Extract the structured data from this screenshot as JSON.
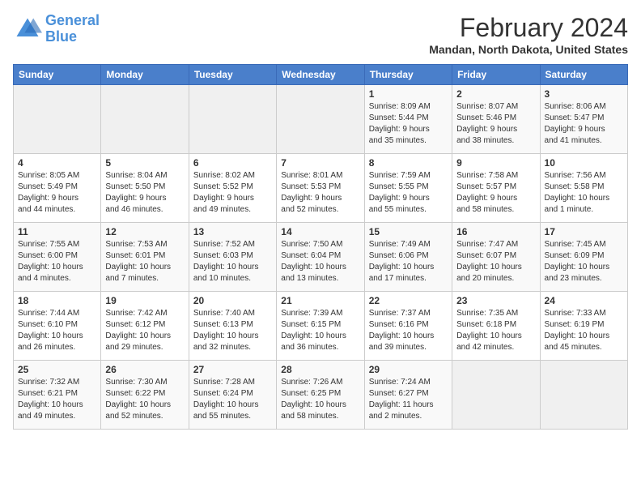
{
  "logo": {
    "line1": "General",
    "line2": "Blue"
  },
  "title": "February 2024",
  "subtitle": "Mandan, North Dakota, United States",
  "days_header": [
    "Sunday",
    "Monday",
    "Tuesday",
    "Wednesday",
    "Thursday",
    "Friday",
    "Saturday"
  ],
  "weeks": [
    [
      {
        "day": "",
        "info": ""
      },
      {
        "day": "",
        "info": ""
      },
      {
        "day": "",
        "info": ""
      },
      {
        "day": "",
        "info": ""
      },
      {
        "day": "1",
        "info": "Sunrise: 8:09 AM\nSunset: 5:44 PM\nDaylight: 9 hours\nand 35 minutes."
      },
      {
        "day": "2",
        "info": "Sunrise: 8:07 AM\nSunset: 5:46 PM\nDaylight: 9 hours\nand 38 minutes."
      },
      {
        "day": "3",
        "info": "Sunrise: 8:06 AM\nSunset: 5:47 PM\nDaylight: 9 hours\nand 41 minutes."
      }
    ],
    [
      {
        "day": "4",
        "info": "Sunrise: 8:05 AM\nSunset: 5:49 PM\nDaylight: 9 hours\nand 44 minutes."
      },
      {
        "day": "5",
        "info": "Sunrise: 8:04 AM\nSunset: 5:50 PM\nDaylight: 9 hours\nand 46 minutes."
      },
      {
        "day": "6",
        "info": "Sunrise: 8:02 AM\nSunset: 5:52 PM\nDaylight: 9 hours\nand 49 minutes."
      },
      {
        "day": "7",
        "info": "Sunrise: 8:01 AM\nSunset: 5:53 PM\nDaylight: 9 hours\nand 52 minutes."
      },
      {
        "day": "8",
        "info": "Sunrise: 7:59 AM\nSunset: 5:55 PM\nDaylight: 9 hours\nand 55 minutes."
      },
      {
        "day": "9",
        "info": "Sunrise: 7:58 AM\nSunset: 5:57 PM\nDaylight: 9 hours\nand 58 minutes."
      },
      {
        "day": "10",
        "info": "Sunrise: 7:56 AM\nSunset: 5:58 PM\nDaylight: 10 hours\nand 1 minute."
      }
    ],
    [
      {
        "day": "11",
        "info": "Sunrise: 7:55 AM\nSunset: 6:00 PM\nDaylight: 10 hours\nand 4 minutes."
      },
      {
        "day": "12",
        "info": "Sunrise: 7:53 AM\nSunset: 6:01 PM\nDaylight: 10 hours\nand 7 minutes."
      },
      {
        "day": "13",
        "info": "Sunrise: 7:52 AM\nSunset: 6:03 PM\nDaylight: 10 hours\nand 10 minutes."
      },
      {
        "day": "14",
        "info": "Sunrise: 7:50 AM\nSunset: 6:04 PM\nDaylight: 10 hours\nand 13 minutes."
      },
      {
        "day": "15",
        "info": "Sunrise: 7:49 AM\nSunset: 6:06 PM\nDaylight: 10 hours\nand 17 minutes."
      },
      {
        "day": "16",
        "info": "Sunrise: 7:47 AM\nSunset: 6:07 PM\nDaylight: 10 hours\nand 20 minutes."
      },
      {
        "day": "17",
        "info": "Sunrise: 7:45 AM\nSunset: 6:09 PM\nDaylight: 10 hours\nand 23 minutes."
      }
    ],
    [
      {
        "day": "18",
        "info": "Sunrise: 7:44 AM\nSunset: 6:10 PM\nDaylight: 10 hours\nand 26 minutes."
      },
      {
        "day": "19",
        "info": "Sunrise: 7:42 AM\nSunset: 6:12 PM\nDaylight: 10 hours\nand 29 minutes."
      },
      {
        "day": "20",
        "info": "Sunrise: 7:40 AM\nSunset: 6:13 PM\nDaylight: 10 hours\nand 32 minutes."
      },
      {
        "day": "21",
        "info": "Sunrise: 7:39 AM\nSunset: 6:15 PM\nDaylight: 10 hours\nand 36 minutes."
      },
      {
        "day": "22",
        "info": "Sunrise: 7:37 AM\nSunset: 6:16 PM\nDaylight: 10 hours\nand 39 minutes."
      },
      {
        "day": "23",
        "info": "Sunrise: 7:35 AM\nSunset: 6:18 PM\nDaylight: 10 hours\nand 42 minutes."
      },
      {
        "day": "24",
        "info": "Sunrise: 7:33 AM\nSunset: 6:19 PM\nDaylight: 10 hours\nand 45 minutes."
      }
    ],
    [
      {
        "day": "25",
        "info": "Sunrise: 7:32 AM\nSunset: 6:21 PM\nDaylight: 10 hours\nand 49 minutes."
      },
      {
        "day": "26",
        "info": "Sunrise: 7:30 AM\nSunset: 6:22 PM\nDaylight: 10 hours\nand 52 minutes."
      },
      {
        "day": "27",
        "info": "Sunrise: 7:28 AM\nSunset: 6:24 PM\nDaylight: 10 hours\nand 55 minutes."
      },
      {
        "day": "28",
        "info": "Sunrise: 7:26 AM\nSunset: 6:25 PM\nDaylight: 10 hours\nand 58 minutes."
      },
      {
        "day": "29",
        "info": "Sunrise: 7:24 AM\nSunset: 6:27 PM\nDaylight: 11 hours\nand 2 minutes."
      },
      {
        "day": "",
        "info": ""
      },
      {
        "day": "",
        "info": ""
      }
    ]
  ]
}
